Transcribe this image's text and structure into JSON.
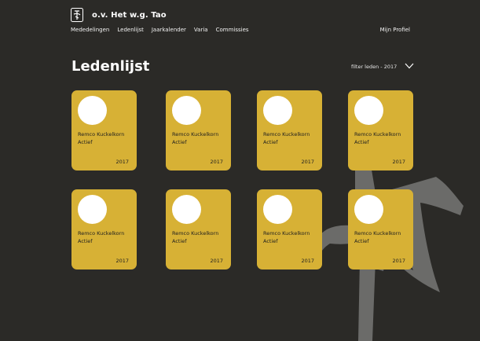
{
  "header": {
    "brand": "o.v. Het w.g. Tao",
    "nav": [
      "Mededelingen",
      "Ledenlijst",
      "Jaarkalender",
      "Varia",
      "Commissies"
    ],
    "profile": "Mijn Profiel"
  },
  "main": {
    "title": "Ledenlijst",
    "filter_label": "filter leden - 2017",
    "members": [
      {
        "name": "Remco Kuckelkorn",
        "status": "Actief",
        "year": "2017"
      },
      {
        "name": "Remco Kuckelkorn",
        "status": "Actief",
        "year": "2017"
      },
      {
        "name": "Remco Kuckelkorn",
        "status": "Actief",
        "year": "2017"
      },
      {
        "name": "Remco Kuckelkorn",
        "status": "Actief",
        "year": "2017"
      },
      {
        "name": "Remco Kuckelkorn",
        "status": "Actief",
        "year": "2017"
      },
      {
        "name": "Remco Kuckelkorn",
        "status": "Actief",
        "year": "2017"
      },
      {
        "name": "Remco Kuckelkorn",
        "status": "Actief",
        "year": "2017"
      },
      {
        "name": "Remco Kuckelkorn",
        "status": "Actief",
        "year": "2017"
      }
    ]
  },
  "colors": {
    "background": "#2b2a27",
    "card": "#d7b135",
    "emblem": "#6b6b69"
  }
}
